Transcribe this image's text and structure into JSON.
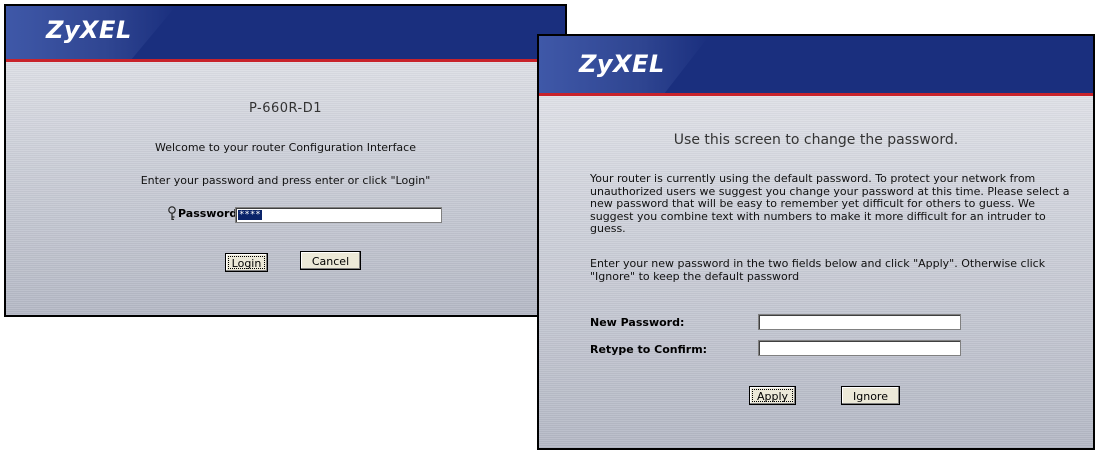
{
  "login": {
    "brand": "ZyXEL",
    "model": "P-660R-D1",
    "welcome": "Welcome to your router Configuration Interface",
    "instruction": "Enter your password and press enter or click \"Login\"",
    "password_label": "Password:",
    "password_value": "****",
    "login_button": "Login",
    "cancel_button": "Cancel"
  },
  "change_password": {
    "brand": "ZyXEL",
    "title": "Use this screen to change the password.",
    "paragraph1": "Your router is currently using the default password. To protect your network from unauthorized users we suggest you change your password at this time. Please select a new password that will be easy to remember yet difficult for others to guess. We suggest you combine text with numbers to make it more difficult for an intruder to guess.",
    "paragraph2": "Enter your new password in the two fields below and click \"Apply\". Otherwise click \"Ignore\" to keep the default password",
    "new_password_label": "New Password:",
    "new_password_value": "",
    "retype_label": "Retype to Confirm:",
    "retype_value": "",
    "apply_button": "Apply",
    "ignore_button": "Ignore"
  },
  "colors": {
    "banner": "#1a2f7e",
    "banner_stripe": "#c8232b",
    "selection": "#0a246a"
  },
  "icons": {
    "password": "key-icon"
  }
}
